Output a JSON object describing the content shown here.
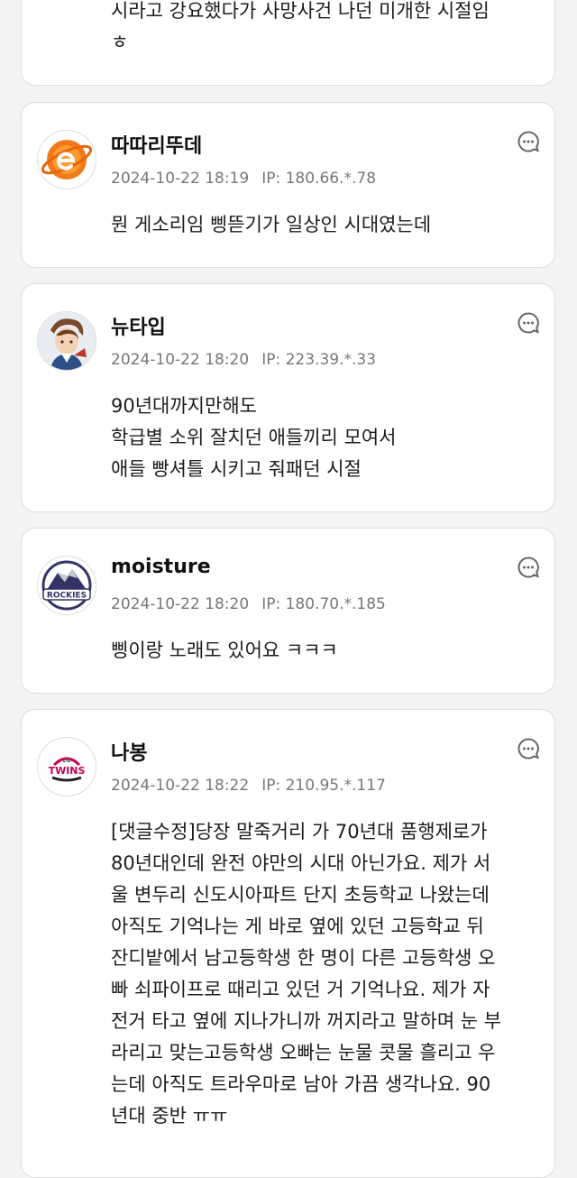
{
  "comments": [
    {
      "lines": [
        "시라고 강요했다가 사망사건 나던 미개한 시절임",
        "ㅎ"
      ]
    },
    {
      "name": "따따리뚜데",
      "date": "2024-10-22 18:19",
      "ip": "IP: 180.66.*.78",
      "avatar_icon": "orange-e-logo-icon",
      "lines": [
        "뭔 게소리임 삥뜯기가 일상인 시대였는데"
      ]
    },
    {
      "name": "뉴타입",
      "date": "2024-10-22 18:20",
      "ip": "IP: 223.39.*.33",
      "avatar_icon": "anime-character-avatar-icon",
      "lines": [
        "90년대까지만해도",
        "학급별 소위 잘치던 애들끼리 모여서",
        "애들 빵셔틀 시키고 줘패던 시절"
      ]
    },
    {
      "name": "moisture",
      "date": "2024-10-22 18:20",
      "ip": "IP: 180.70.*.185",
      "avatar_icon": "rockies-logo-icon",
      "avatar_text": "ROCKIES",
      "lines": [
        "삥이랑 노래도 있어요 ㅋㅋㅋ"
      ]
    },
    {
      "name": "나봉",
      "date": "2024-10-22 18:22",
      "ip": "IP: 210.95.*.117",
      "avatar_icon": "lg-twins-logo-icon",
      "avatar_text": "TWINS",
      "avatar_small": "LG",
      "lines": [
        "[댓글수정]당장 말죽거리 가 70년대 품행제로가",
        "80년대인데 완전 야만의 시대 아닌가요. 제가 서",
        "울 변두리 신도시아파트 단지 초등학교 나왔는데",
        "아직도 기억나는 게 바로 옆에 있던 고등학교 뒤",
        "잔디밭에서 남고등학생 한 명이 다른 고등학생 오",
        "빠 쇠파이프로 때리고 있던 거 기억나요. 제가 자",
        "전거 타고 옆에 지나가니까 꺼지라고 말하며 눈 부",
        "라리고 맞는고등학생 오빠는 눈물 콧물 흘리고 우",
        "는데 아직도 트라우마로 남아 가끔 생각나요. 90",
        "년대 중반 ㅠㅠ"
      ]
    }
  ]
}
